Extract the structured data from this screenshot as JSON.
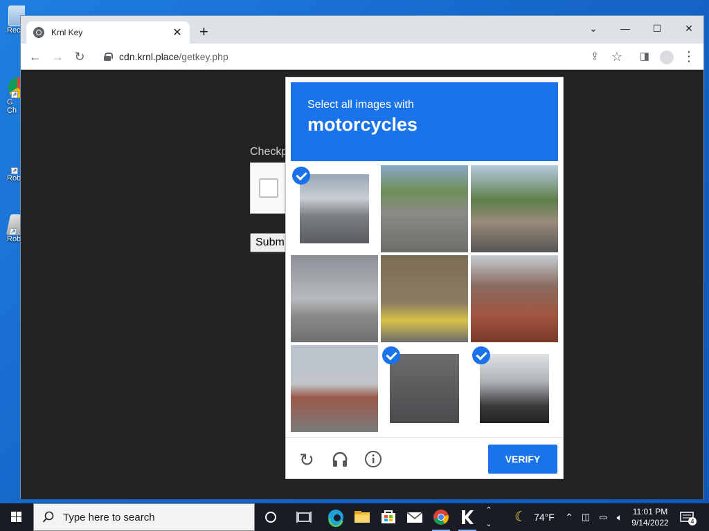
{
  "desktop": {
    "icons": [
      {
        "label": "Rec",
        "name": "recycle-bin"
      },
      {
        "label": "G",
        "label2": "Ch",
        "name": "google-chrome"
      },
      {
        "label": "Roblo",
        "name": "roblox-1"
      },
      {
        "label": "Roblo",
        "name": "roblox-2"
      }
    ]
  },
  "browser": {
    "tab_title": "Krnl Key",
    "new_tab_label": "+",
    "url_host": "cdn.krnl.place",
    "url_path": "/getkey.php"
  },
  "page": {
    "checkpoint_label": "Checkp",
    "submit_label": "Subm"
  },
  "captcha": {
    "prompt_line1": "Select all images with",
    "prompt_line2": "motorcycles",
    "verify_label": "VERIFY",
    "tiles": [
      {
        "name": "tile-1",
        "description": "street-motorcycle-parked",
        "selected": true
      },
      {
        "name": "tile-2",
        "description": "crosswalk-bus",
        "selected": false
      },
      {
        "name": "tile-3",
        "description": "mountain-road-bridge",
        "selected": false
      },
      {
        "name": "tile-4",
        "description": "highway-overpass",
        "selected": false
      },
      {
        "name": "tile-5",
        "description": "yellow-taxi",
        "selected": false
      },
      {
        "name": "tile-6",
        "description": "brick-house",
        "selected": false
      },
      {
        "name": "tile-7",
        "description": "traffic-light-intersection",
        "selected": false
      },
      {
        "name": "tile-8",
        "description": "motorcyclist-on-road",
        "selected": true
      },
      {
        "name": "tile-9",
        "description": "parked-motorcycles",
        "selected": true
      }
    ]
  },
  "taskbar": {
    "search_placeholder": "Type here to search",
    "weather_temp": "74°F",
    "time": "11:01 PM",
    "date": "9/14/2022",
    "notification_count": "4"
  }
}
